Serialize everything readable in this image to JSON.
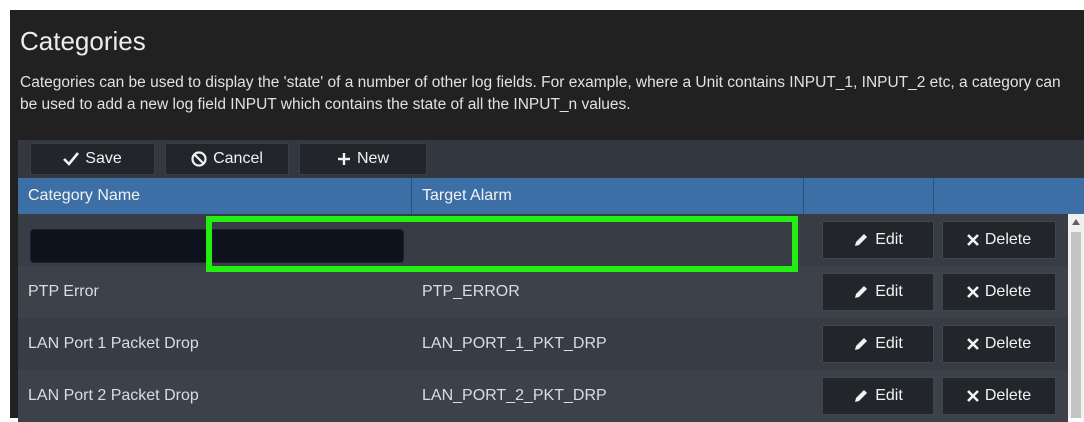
{
  "page": {
    "title": "Categories",
    "description": "Categories can be used to display the 'state' of a number of other log fields. For example, where a Unit contains INPUT_1, INPUT_2 etc, a category can be used to add a new log field INPUT which contains the state of all the INPUT_n values."
  },
  "toolbar": {
    "save_label": "Save",
    "cancel_label": "Cancel",
    "new_label": "New"
  },
  "table": {
    "columns": [
      "Category Name",
      "Target Alarm",
      "",
      ""
    ],
    "edit_label": "Edit",
    "delete_label": "Delete",
    "new_row": {
      "name_value": "",
      "target_alarm": ""
    },
    "rows": [
      {
        "name": "PTP Error",
        "target_alarm": "PTP_ERROR"
      },
      {
        "name": "LAN Port 1 Packet Drop",
        "target_alarm": "LAN_PORT_1_PKT_DRP"
      },
      {
        "name": "LAN Port 2 Packet Drop",
        "target_alarm": "LAN_PORT_2_PKT_DRP"
      }
    ]
  },
  "colors": {
    "panel_bg": "#212121",
    "header_bg": "#3c6fa6",
    "highlight": "#22ee11"
  },
  "icons": {
    "save": "check-icon",
    "cancel": "ban-icon",
    "new": "plus-icon",
    "edit": "pencil-icon",
    "delete": "x-icon"
  }
}
